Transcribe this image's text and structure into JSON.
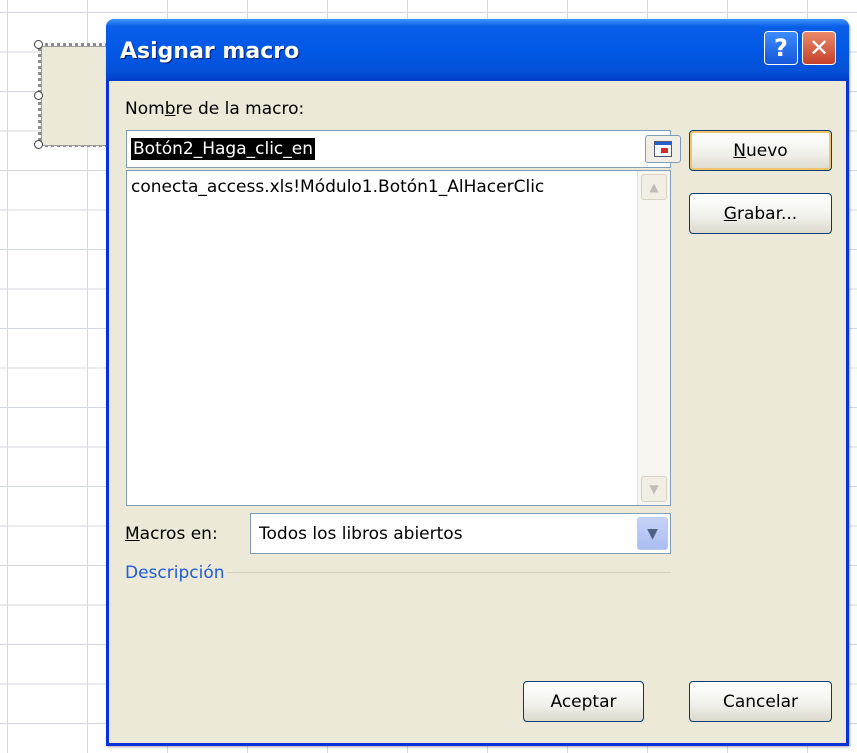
{
  "dialog": {
    "title": "Asignar macro",
    "help_symbol": "?",
    "close_symbol": "✕"
  },
  "macro_name": {
    "label_pre": "Nom",
    "label_accel": "b",
    "label_post": "re de la macro:",
    "value": "Botón2_Haga_clic_en"
  },
  "macro_list": {
    "items": [
      "conecta_access.xls!Módulo1.Botón1_AlHacerClic"
    ]
  },
  "buttons": {
    "new": {
      "accel": "N",
      "rest": "uevo"
    },
    "record": {
      "accel": "G",
      "rest": "rabar..."
    },
    "ok": "Aceptar",
    "cancel": "Cancelar"
  },
  "macros_in": {
    "label_accel": "M",
    "label_rest": "acros en:",
    "selected": "Todos los libros abiertos"
  },
  "description": {
    "label": "Descripción",
    "color": "#1f5bd6"
  },
  "colors": {
    "title_bar": "#0058e6",
    "dialog_bg": "#ece9d8",
    "close_button": "#c6402a"
  }
}
